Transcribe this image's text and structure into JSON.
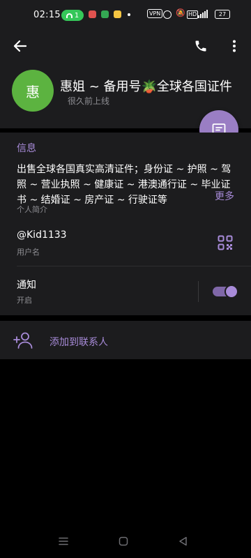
{
  "status_bar": {
    "time": "02:15",
    "call_badge": "1",
    "vpn": "VPN",
    "hd": "HD",
    "battery": "27"
  },
  "header": {
    "back_icon": "arrow-left-icon",
    "call_icon": "phone-icon",
    "more_icon": "more-vertical-icon",
    "avatar_letter": "惠",
    "avatar_color": "#5cb340",
    "name": "惠姐 ~ 备用号🪴全球各国证件",
    "last_seen": "很久前上线",
    "message_fab_icon": "message-icon"
  },
  "info": {
    "section_title": "信息",
    "bio": "出售全球各国真实高清证件；身份证 ~ 护照 ~ 驾照 ~ 营业执照 ~ 健康证 ~ 港澳通行证 ~ 毕业证书 ~ 结婚证 ~ 房产证 ~ 行驶证等",
    "bio_more": "更多",
    "bio_label": "个人简介",
    "username": "@Kid1133",
    "username_label": "用户名",
    "qr_icon": "qr-code-icon",
    "notifications_title": "通知",
    "notifications_state": "开启",
    "notifications_on": true
  },
  "actions": {
    "add_contact_icon": "add-user-icon",
    "add_contact_label": "添加到联系人"
  },
  "nav_bar": {
    "menu_icon": "menu-icon",
    "home_icon": "home-icon",
    "back_icon": "back-triangle-icon"
  },
  "colors": {
    "accent": "#a88bd9",
    "fab": "#9a7ec4",
    "surface": "#1c1c1e",
    "background": "#000000"
  }
}
